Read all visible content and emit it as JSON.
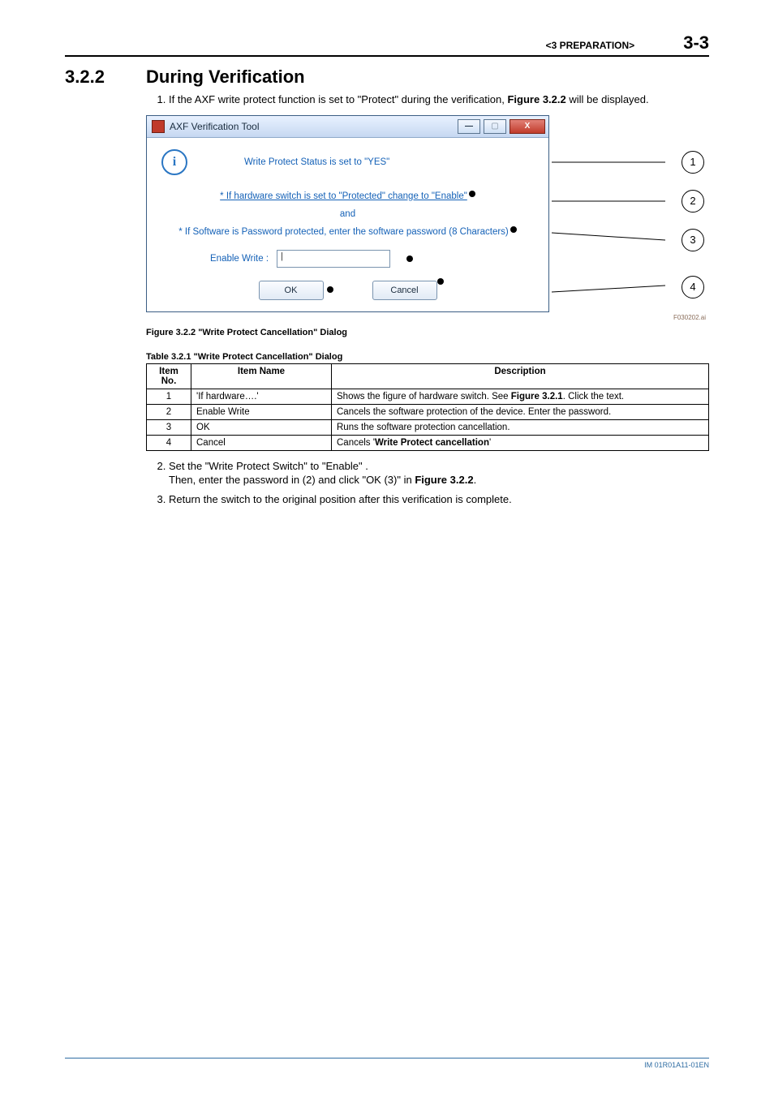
{
  "header": {
    "chapter": "<3  PREPARATION>",
    "page_number": "3-3"
  },
  "section": {
    "number": "3.2.2",
    "title": "During Verification"
  },
  "intro_item": {
    "text_before": "If the AXF write protect function is set to \"Protect\" during the verification, ",
    "figref": "Figure 3.2.2",
    "text_after": " will be displayed."
  },
  "dialog": {
    "title": "AXF Verification Tool",
    "minimize_glyph": "—",
    "maximize_glyph": "▢",
    "close_glyph": "X",
    "info_glyph": "i",
    "status_line": "Write Protect Status is set to \"YES\"",
    "hw_link": "* If hardware switch is set to \"Protected\" change to \"Enable\"",
    "and": "and",
    "sw_line": "* If Software is Password protected, enter the software password (8 Characters)",
    "enable_write_label": "Enable Write :",
    "caret": "|",
    "ok": "OK",
    "cancel": "Cancel"
  },
  "callouts": {
    "c1": "1",
    "c2": "2",
    "c3": "3",
    "c4": "4"
  },
  "fig_small_label": "F030202.ai",
  "fig_caption": "Figure 3.2.2 \"Write Protect Cancellation\" Dialog",
  "table_caption": "Table 3.2.1 \"Write Protect Cancellation\" Dialog",
  "table": {
    "headers": {
      "no": "Item No.",
      "name": "Item Name",
      "desc": "Description"
    },
    "rows": [
      {
        "no": "1",
        "name": "'If hardware….'",
        "desc_before": "Shows the figure of hardware switch. See ",
        "desc_bold": "Figure 3.2.1",
        "desc_after": ". Click the text."
      },
      {
        "no": "2",
        "name": "Enable Write",
        "desc_before": "Cancels the software protection of the device. Enter the password.",
        "desc_bold": "",
        "desc_after": ""
      },
      {
        "no": "3",
        "name": "OK",
        "desc_before": "Runs the software protection cancellation.",
        "desc_bold": "",
        "desc_after": ""
      },
      {
        "no": "4",
        "name": "Cancel",
        "desc_before": "Cancels '",
        "desc_bold": "Write Protect cancellation",
        "desc_after": "'"
      }
    ]
  },
  "step2": {
    "line1": "Set the \"Write Protect Switch\" to \"Enable\" .",
    "line2_before": "Then, enter the password in (2) and click \"OK (3)\" in ",
    "line2_bold": "Figure 3.2.2",
    "line2_after": "."
  },
  "step3": "Return the switch to the original position after this verification is complete.",
  "footer_code": "IM 01R01A11-01EN"
}
